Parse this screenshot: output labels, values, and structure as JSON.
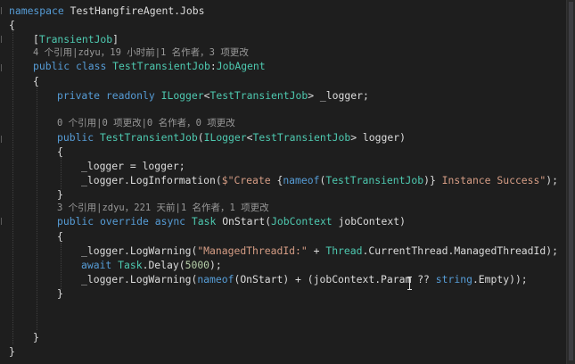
{
  "editor": {
    "lines": {
      "l1": {
        "kw": "namespace",
        "name": "TestHangfireAgent.Jobs"
      },
      "l2": {
        "text": "{"
      },
      "l3": {
        "open": "[",
        "attr": "TransientJob",
        "close": "]"
      },
      "lens1": {
        "text": "4 个引用|zdyu，19 小时前|1 名作者，3 项更改"
      },
      "l4": {
        "kw1": "public",
        "kw2": "class",
        "type1": "TestTransientJob",
        "colon": ":",
        "type2": "JobAgent"
      },
      "l5": {
        "text": "{"
      },
      "l6": {
        "kw1": "private",
        "kw2": "readonly",
        "type1": "ILogger",
        "lt": "<",
        "type2": "TestTransientJob",
        "gt": ">",
        "rest": " _logger;"
      },
      "lens2": {
        "text": "0 个引用|0 项更改|0 名作者，0 项更改"
      },
      "l7": {
        "kw1": "public",
        "type1": "TestTransientJob",
        "p1": "(",
        "type2": "ILogger",
        "lt": "<",
        "type3": "TestTransientJob",
        "rest": "> logger)"
      },
      "l8": {
        "text": "{"
      },
      "l9": {
        "text": "_logger = logger;"
      },
      "l10": {
        "pre": "_logger.LogInformation(",
        "s1": "$\"Create ",
        "b1": "{",
        "kw": "nameof",
        "p1": "(",
        "type": "TestTransientJob",
        "p2": ")",
        "b2": "}",
        "s2": " Instance Success\"",
        "post": ");"
      },
      "l11": {
        "text": "}"
      },
      "lens3": {
        "text": "3 个引用|zdyu，221 天前|1 名作者，1 项更改"
      },
      "l12": {
        "kw1": "public",
        "kw2": "override",
        "kw3": "async",
        "type1": "Task",
        "mid": " OnStart(",
        "type2": "JobContext",
        "rest": " jobContext)"
      },
      "l13": {
        "text": "{"
      },
      "l14": {
        "pre": "_logger.LogWarning(",
        "str": "\"ManagedThreadId:\"",
        "mid": " + ",
        "type": "Thread",
        "rest": ".CurrentThread.ManagedThreadId);"
      },
      "l15": {
        "kw": "await",
        "type": "Task",
        "mid": ".Delay(",
        "num": "5000",
        "post": ");"
      },
      "l16": {
        "pre": "_logger.LogWarning(",
        "kw1": "nameof",
        "mid": "(OnStart) + (jobContext.Param ?? ",
        "kw2": "string",
        "post": ".Empty));"
      },
      "l17": {
        "text": "}"
      },
      "l18": {
        "text": "}"
      },
      "l19": {
        "text": "}"
      }
    }
  },
  "colors": {
    "background": "#1e1e1e",
    "keyword": "#569cd6",
    "type": "#4ec9b0",
    "string": "#d69d85",
    "number": "#b5cea8",
    "text": "#dcdcdc",
    "codelens": "#999999"
  },
  "icons": {
    "cursor": "ibeam-cursor-icon"
  }
}
